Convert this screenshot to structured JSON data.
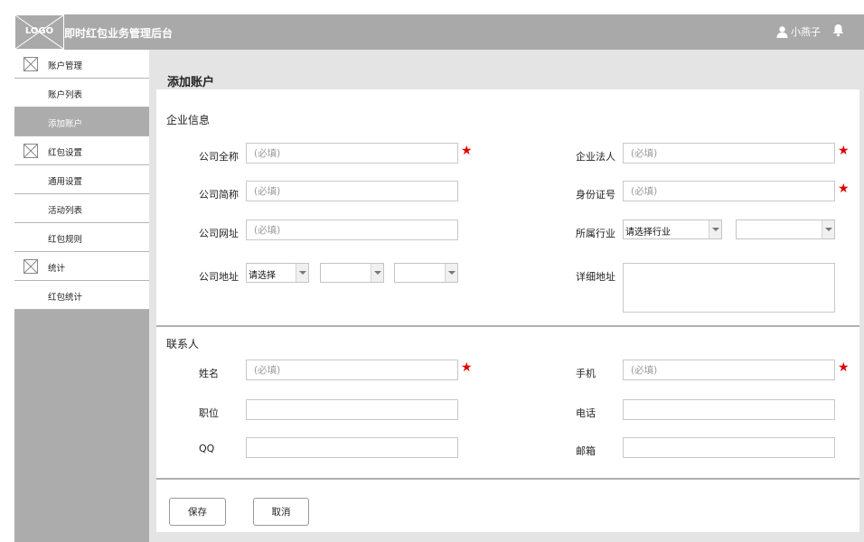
{
  "header": {
    "logo_text": "LOGO",
    "app_title": "即时红包业务管理后台",
    "user_name": "小燕子"
  },
  "sidebar": {
    "items": [
      {
        "label": "账户管理",
        "type": "group"
      },
      {
        "label": "账户列表",
        "type": "item"
      },
      {
        "label": "添加账户",
        "type": "item",
        "active": true
      },
      {
        "label": "红包设置",
        "type": "group"
      },
      {
        "label": "通用设置",
        "type": "item"
      },
      {
        "label": "活动列表",
        "type": "item"
      },
      {
        "label": "红包规则",
        "type": "item"
      },
      {
        "label": "统计",
        "type": "group"
      },
      {
        "label": "红包统计",
        "type": "item"
      }
    ]
  },
  "page": {
    "title": "添加账户"
  },
  "company_section": {
    "title": "企业信息",
    "full_name_label": "公司全称",
    "short_name_label": "公司简称",
    "website_label": "公司网址",
    "address_label": "公司地址",
    "address_select_value": "请选择",
    "legal_person_label": "企业法人",
    "id_number_label": "身份证号",
    "industry_label": "所属行业",
    "industry_select_value": "请选择行业",
    "detail_address_label": "详细地址",
    "required_placeholder": "(必填)"
  },
  "contact_section": {
    "title": "联系人",
    "name_label": "姓名",
    "position_label": "职位",
    "qq_label": "QQ",
    "mobile_label": "手机",
    "phone_label": "电话",
    "email_label": "邮箱",
    "required_placeholder": "(必填)"
  },
  "actions": {
    "save_label": "保存",
    "cancel_label": "取消"
  },
  "colors": {
    "header_bg": "#a9a9a9",
    "sidebar_bg": "#acacac",
    "required_star": "#e00000",
    "main_bg": "#e4e4e4"
  }
}
